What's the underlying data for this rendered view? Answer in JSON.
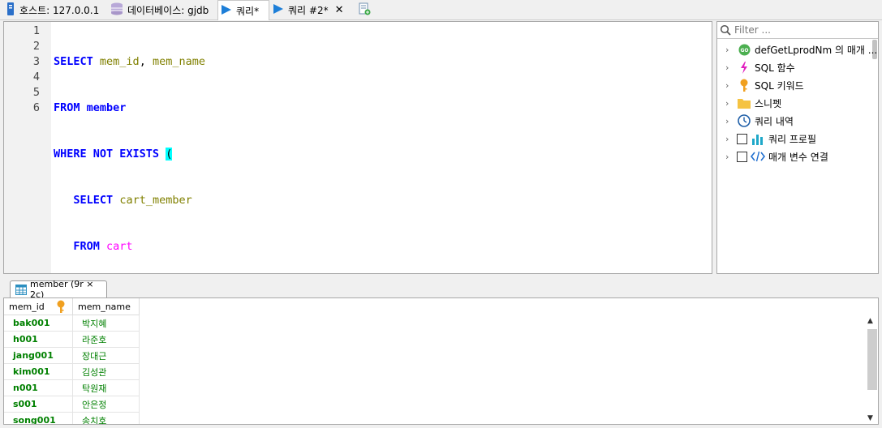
{
  "tabs": [
    {
      "label": "호스트: 127.0.0.1",
      "icon": "server-icon"
    },
    {
      "label": "데이터베이스: gjdb",
      "icon": "database-icon"
    },
    {
      "label": "쿼리*",
      "icon": "play-icon",
      "active": true
    },
    {
      "label": "쿼리 #2*",
      "icon": "play-icon",
      "close": "✕"
    }
  ],
  "editor": {
    "line_numbers": [
      "1",
      "2",
      "3",
      "4",
      "5",
      "6"
    ]
  },
  "sidebar": {
    "filter_placeholder": "Filter ...",
    "items": [
      {
        "label": "defGetLprodNm 의 매개 ...",
        "icon": "go-icon"
      },
      {
        "label": "SQL 함수",
        "icon": "lightning-icon"
      },
      {
        "label": "SQL 키워드",
        "icon": "key-icon"
      },
      {
        "label": "스니펫",
        "icon": "folder-icon"
      },
      {
        "label": "쿼리 내역",
        "icon": "clock-icon"
      },
      {
        "label": "쿼리 프로필",
        "icon": "bar-chart-icon",
        "checkbox": false
      },
      {
        "label": "매개 변수 연결",
        "icon": "code-icon",
        "checkbox": false
      }
    ]
  },
  "results": {
    "tab_label": "member (9r × 2c)",
    "columns": [
      "mem_id",
      "mem_name"
    ],
    "rows": [
      [
        "bak001",
        "박지혜"
      ],
      [
        "h001",
        "라준호"
      ],
      [
        "jang001",
        "장대근"
      ],
      [
        "kim001",
        "김성관"
      ],
      [
        "n001",
        "탁원재"
      ],
      [
        "s001",
        "안은정"
      ],
      [
        "song001",
        "송치호"
      ]
    ]
  },
  "colors": {
    "keyword": "#0000ff",
    "identifier": "#808000",
    "table": "#ff00ff",
    "bracket_highlight": "#00ffff",
    "result_text": "#008000"
  }
}
